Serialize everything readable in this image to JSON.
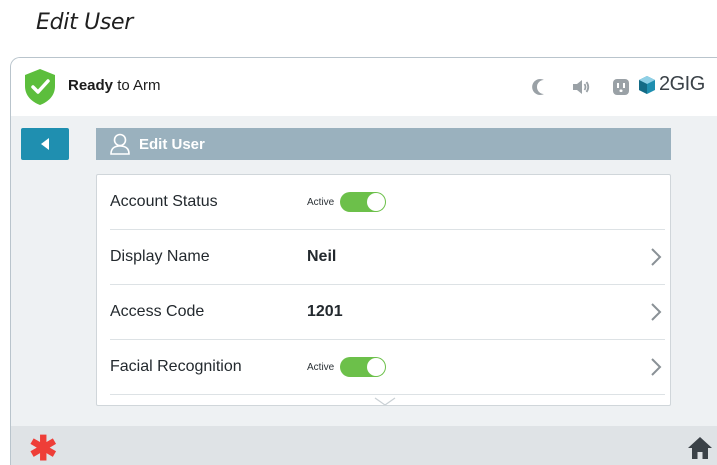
{
  "caption": "Edit User",
  "status_bar": {
    "status_bold": "Ready",
    "status_rest": " to Arm",
    "brand": "2GIG",
    "icons": [
      "moon-icon",
      "speaker-icon",
      "outlet-icon"
    ]
  },
  "header": {
    "title": "Edit User"
  },
  "rows": [
    {
      "label": "Account Status",
      "toggle_label": "Active",
      "toggle_on": true
    },
    {
      "label": "Display Name",
      "value": "Neil"
    },
    {
      "label": "Access Code",
      "value": "1201"
    },
    {
      "label": "Facial Recognition",
      "toggle_label": "Active",
      "toggle_on": true
    }
  ],
  "colors": {
    "accent": "#1f8fb0",
    "header_bar": "#9ab1be",
    "toggle_on": "#6cc04a",
    "shield": "#5cbe3c",
    "emergency": "#ee3e38"
  }
}
